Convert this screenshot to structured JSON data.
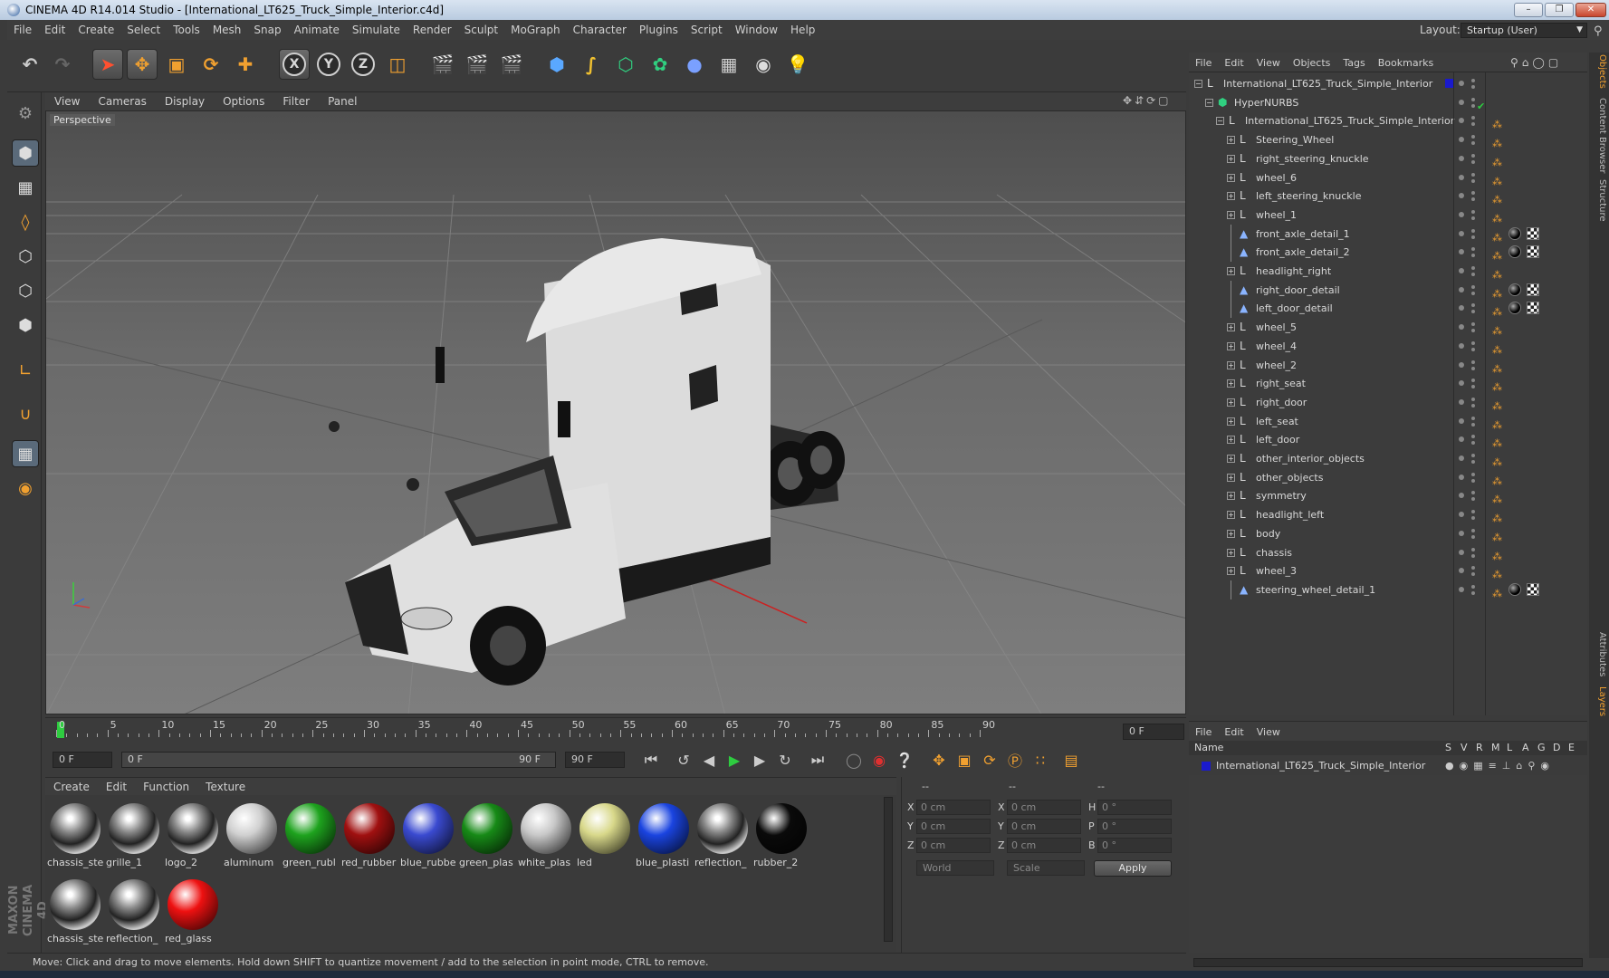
{
  "window": {
    "title": "CINEMA 4D R14.014 Studio - [International_LT625_Truck_Simple_Interior.c4d]"
  },
  "menu": [
    "File",
    "Edit",
    "Create",
    "Select",
    "Tools",
    "Mesh",
    "Snap",
    "Animate",
    "Simulate",
    "Render",
    "Sculpt",
    "MoGraph",
    "Character",
    "Plugins",
    "Script",
    "Window",
    "Help"
  ],
  "layout": {
    "label": "Layout:",
    "value": "Startup (User)"
  },
  "viewport": {
    "menu": [
      "View",
      "Cameras",
      "Display",
      "Options",
      "Filter",
      "Panel"
    ],
    "label": "Perspective"
  },
  "timeline": {
    "ticks": [
      "0",
      "5",
      "10",
      "15",
      "20",
      "25",
      "30",
      "35",
      "40",
      "45",
      "50",
      "55",
      "60",
      "65",
      "70",
      "75",
      "80",
      "85",
      "90"
    ],
    "current_frame": "0 F",
    "start_field": "0 F",
    "range_start": "0 F",
    "range_end": "90 F",
    "end_field": "90 F"
  },
  "materials": {
    "menu": [
      "Create",
      "Edit",
      "Function",
      "Texture"
    ],
    "items": [
      {
        "label": "chassis_ste",
        "color": "chrome"
      },
      {
        "label": "grille_1",
        "color": "chrome"
      },
      {
        "label": "logo_2",
        "color": "chrome"
      },
      {
        "label": "aluminum",
        "color": "#d0d0d0"
      },
      {
        "label": "green_rubl",
        "color": "#1ea31e"
      },
      {
        "label": "red_rubber",
        "color": "#a01010"
      },
      {
        "label": "blue_rubbe",
        "color": "#3a4ad0"
      },
      {
        "label": "green_plas",
        "color": "#178a17"
      },
      {
        "label": "white_plas",
        "color": "#c8c8c8"
      },
      {
        "label": "led",
        "color": "#d8d88a"
      },
      {
        "label": "blue_plasti",
        "color": "#1a44e0"
      },
      {
        "label": "reflection_",
        "color": "chrome"
      },
      {
        "label": "rubber_2",
        "color": "#0a0a0a"
      },
      {
        "label": "chassis_ste",
        "color": "chrome"
      },
      {
        "label": "reflection_",
        "color": "chrome"
      },
      {
        "label": "red_glass",
        "color": "#ee1111"
      }
    ]
  },
  "coords": {
    "headers": [
      "--",
      "--",
      "--"
    ],
    "rows": [
      {
        "a": "X",
        "av": "0 cm",
        "b": "X",
        "bv": "0 cm",
        "c": "H",
        "cv": "0 °"
      },
      {
        "a": "Y",
        "av": "0 cm",
        "b": "Y",
        "bv": "0 cm",
        "c": "P",
        "cv": "0 °"
      },
      {
        "a": "Z",
        "av": "0 cm",
        "b": "Z",
        "bv": "0 cm",
        "c": "B",
        "cv": "0 °"
      }
    ],
    "dropdown1": "World",
    "dropdown2": "Scale",
    "apply": "Apply"
  },
  "objects": {
    "menu": [
      "File",
      "Edit",
      "View",
      "Objects",
      "Tags",
      "Bookmarks"
    ],
    "tree": [
      {
        "name": "International_LT625_Truck_Simple_Interior",
        "depth": 0,
        "type": "null",
        "tags": "layer"
      },
      {
        "name": "HyperNURBS",
        "depth": 1,
        "type": "nurbs",
        "tags": "check"
      },
      {
        "name": "International_LT625_Truck_Simple_Interior",
        "depth": 2,
        "type": "null",
        "tags": "tag"
      },
      {
        "name": "Steering_Wheel",
        "depth": 3,
        "type": "null",
        "tags": "tag"
      },
      {
        "name": "right_steering_knuckle",
        "depth": 3,
        "type": "null",
        "tags": "tag"
      },
      {
        "name": "wheel_6",
        "depth": 3,
        "type": "null",
        "tags": "tag"
      },
      {
        "name": "left_steering_knuckle",
        "depth": 3,
        "type": "null",
        "tags": "tag"
      },
      {
        "name": "wheel_1",
        "depth": 3,
        "type": "null",
        "tags": "tag"
      },
      {
        "name": "front_axle_detail_1",
        "depth": 3,
        "type": "poly",
        "tags": "mat"
      },
      {
        "name": "front_axle_detail_2",
        "depth": 3,
        "type": "poly",
        "tags": "mat"
      },
      {
        "name": "headlight_right",
        "depth": 3,
        "type": "null",
        "tags": "tag"
      },
      {
        "name": "right_door_detail",
        "depth": 3,
        "type": "poly",
        "tags": "mat"
      },
      {
        "name": "left_door_detail",
        "depth": 3,
        "type": "poly",
        "tags": "mat"
      },
      {
        "name": "wheel_5",
        "depth": 3,
        "type": "null",
        "tags": "tag"
      },
      {
        "name": "wheel_4",
        "depth": 3,
        "type": "null",
        "tags": "tag"
      },
      {
        "name": "wheel_2",
        "depth": 3,
        "type": "null",
        "tags": "tag"
      },
      {
        "name": "right_seat",
        "depth": 3,
        "type": "null",
        "tags": "tag"
      },
      {
        "name": "right_door",
        "depth": 3,
        "type": "null",
        "tags": "tag"
      },
      {
        "name": "left_seat",
        "depth": 3,
        "type": "null",
        "tags": "tag"
      },
      {
        "name": "left_door",
        "depth": 3,
        "type": "null",
        "tags": "tag"
      },
      {
        "name": "other_interior_objects",
        "depth": 3,
        "type": "null",
        "tags": "tag"
      },
      {
        "name": "other_objects",
        "depth": 3,
        "type": "null",
        "tags": "tag"
      },
      {
        "name": "symmetry",
        "depth": 3,
        "type": "null",
        "tags": "tag"
      },
      {
        "name": "headlight_left",
        "depth": 3,
        "type": "null",
        "tags": "tag"
      },
      {
        "name": "body",
        "depth": 3,
        "type": "null",
        "tags": "tag"
      },
      {
        "name": "chassis",
        "depth": 3,
        "type": "null",
        "tags": "tag"
      },
      {
        "name": "wheel_3",
        "depth": 3,
        "type": "null",
        "tags": "tag"
      },
      {
        "name": "steering_wheel_detail_1",
        "depth": 3,
        "type": "poly",
        "tags": "mat"
      }
    ]
  },
  "layers": {
    "menu": [
      "File",
      "Edit",
      "View"
    ],
    "header": {
      "name": "Name",
      "cols": [
        "S",
        "V",
        "R",
        "M",
        "L",
        "A",
        "G",
        "D",
        "E"
      ]
    },
    "rows": [
      {
        "name": "International_LT625_Truck_Simple_Interior",
        "color": "#1a1acc"
      }
    ]
  },
  "right_tabs": [
    "Objects",
    "Content Browser",
    "Structure",
    "Attributes",
    "Layers"
  ],
  "status": "Move: Click and drag to move elements. Hold down SHIFT to quantize movement / add to the selection in point mode, CTRL to remove.",
  "brand": "MAXON CINEMA 4D",
  "colors": {
    "accent": "#2ecc40",
    "panel": "#3b3b3b",
    "tag_orange": "#f0a030"
  }
}
